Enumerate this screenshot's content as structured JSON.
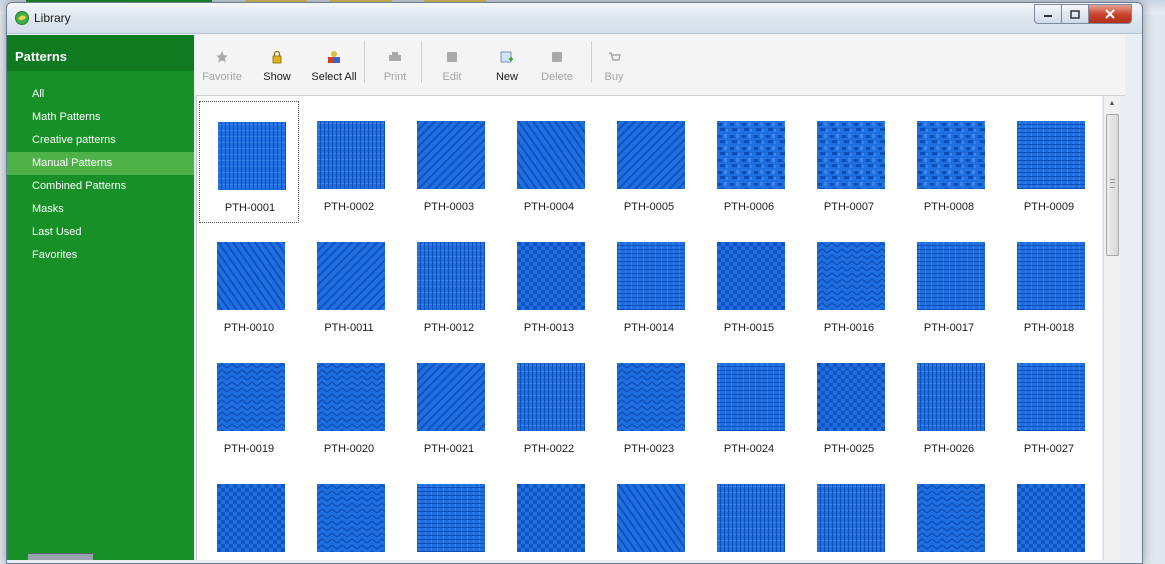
{
  "window": {
    "title": "Library"
  },
  "sidebar": {
    "header": "Patterns",
    "items": [
      {
        "label": "All",
        "active": false
      },
      {
        "label": "Math Patterns",
        "active": false
      },
      {
        "label": "Creative patterns",
        "active": false
      },
      {
        "label": "Manual Patterns",
        "active": true
      },
      {
        "label": "Combined Patterns",
        "active": false
      },
      {
        "label": "Masks",
        "active": false
      },
      {
        "label": "Last Used",
        "active": false
      },
      {
        "label": "Favorites",
        "active": false
      }
    ]
  },
  "toolbar": {
    "buttons": [
      {
        "label": "Favorite",
        "icon": "star-icon",
        "enabled": false
      },
      {
        "label": "Show",
        "icon": "lock-icon",
        "enabled": true
      },
      {
        "label": "Select All",
        "icon": "shapes-icon",
        "enabled": true
      },
      {
        "label": "Print",
        "icon": "printer-icon",
        "enabled": false
      },
      {
        "label": "Edit",
        "icon": "edit-icon",
        "enabled": false
      },
      {
        "label": "New",
        "icon": "new-icon",
        "enabled": true
      },
      {
        "label": "Delete",
        "icon": "delete-icon",
        "enabled": false
      },
      {
        "label": "Buy",
        "icon": "cart-icon",
        "enabled": false
      }
    ]
  },
  "patterns": [
    {
      "label": "PTH-0001",
      "style": "v"
    },
    {
      "label": "PTH-0002",
      "style": "v"
    },
    {
      "label": "PTH-0003",
      "style": "d1"
    },
    {
      "label": "PTH-0004",
      "style": "d2"
    },
    {
      "label": "PTH-0005",
      "style": "d1"
    },
    {
      "label": "PTH-0006",
      "style": "noise"
    },
    {
      "label": "PTH-0007",
      "style": "noise"
    },
    {
      "label": "PTH-0008",
      "style": "noise"
    },
    {
      "label": "PTH-0009",
      "style": "h"
    },
    {
      "label": "PTH-0010",
      "style": "d2"
    },
    {
      "label": "PTH-0011",
      "style": "d1"
    },
    {
      "label": "PTH-0012",
      "style": "v"
    },
    {
      "label": "PTH-0013",
      "style": "check"
    },
    {
      "label": "PTH-0014",
      "style": "h"
    },
    {
      "label": "PTH-0015",
      "style": "check"
    },
    {
      "label": "PTH-0016",
      "style": "zig"
    },
    {
      "label": "PTH-0017",
      "style": "h"
    },
    {
      "label": "PTH-0018",
      "style": "h"
    },
    {
      "label": "PTH-0019",
      "style": "zig"
    },
    {
      "label": "PTH-0020",
      "style": "zig"
    },
    {
      "label": "PTH-0021",
      "style": "d1"
    },
    {
      "label": "PTH-0022",
      "style": "v"
    },
    {
      "label": "PTH-0023",
      "style": "zig"
    },
    {
      "label": "PTH-0024",
      "style": "h"
    },
    {
      "label": "PTH-0025",
      "style": "check"
    },
    {
      "label": "PTH-0026",
      "style": "v"
    },
    {
      "label": "PTH-0027",
      "style": "h"
    },
    {
      "label": "",
      "style": "check"
    },
    {
      "label": "",
      "style": "zig"
    },
    {
      "label": "",
      "style": "h"
    },
    {
      "label": "",
      "style": "check"
    },
    {
      "label": "",
      "style": "d2"
    },
    {
      "label": "",
      "style": "v"
    },
    {
      "label": "",
      "style": "v"
    },
    {
      "label": "",
      "style": "zig"
    },
    {
      "label": "",
      "style": "check"
    }
  ],
  "selected_pattern": "PTH-0001",
  "colors": {
    "sidebar": "#179127",
    "sidebar_active": "#4fb248",
    "swatch": "#1f6fe0"
  }
}
